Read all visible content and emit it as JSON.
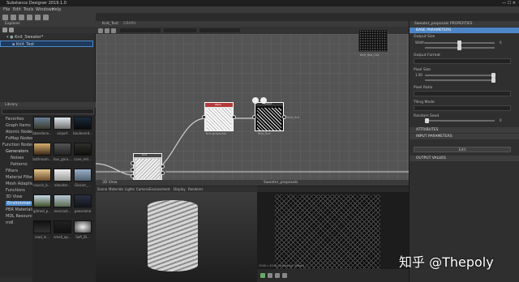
{
  "window": {
    "title": "Substance Designer 2019.1.0"
  },
  "menu": [
    "File",
    "Edit",
    "Tools",
    "Windows",
    "Help"
  ],
  "explorer": {
    "title": "Explorer",
    "package": "Knit_Sweater*",
    "graph": "Knit_Test"
  },
  "library": {
    "title": "Library",
    "categories": [
      "Favorites",
      "Graph Items",
      "Atomic Nodes",
      "FxMap Nodes",
      "Function Nodes",
      "Generators",
      "Noises",
      "Patterns",
      "Filters",
      "Material Filters",
      "Mesh Adaptive",
      "Functions",
      "3D View",
      "Environments",
      "PBR Materials",
      "MDL Resources",
      "mdl"
    ],
    "thumb_labels": [
      "abandone...",
      "airport",
      "boulevard...",
      "bathroom...",
      "bus_gara...",
      "cave_ent...",
      "cousin_b...",
      "elevator...",
      "Glacier_...",
      "gilmed_p...",
      "overcast...",
      "panorama",
      "road_in...",
      "small_ap...",
      "Soft_Bl..."
    ]
  },
  "graph_tab": {
    "title": "Knit_Test",
    "subtitle": "GRAPH"
  },
  "nodes": {
    "first": {
      "title": "Knit"
    },
    "warp": {
      "title": "Warp",
      "caption": "Knit grayscale"
    },
    "output": {
      "title": "Output",
      "caption": "Knit_Out",
      "tag": "Knit_Out"
    }
  },
  "graph_corner_caption": "Knit_Test_Out",
  "view3d": {
    "title": "3D View",
    "menu": [
      "Scene",
      "Materials",
      "Lights",
      "Camera",
      "Environment",
      "Display",
      "Renderer"
    ]
  },
  "view2d": {
    "title": "Sweater_proposals",
    "size": "2048 x 2048 (Grayscale, 16bpc)"
  },
  "properties": {
    "title": "Sweater_proposals",
    "tab": "PROPERTIES",
    "section_base": "BASE PARAMETERS",
    "params": [
      {
        "label": "Output Size",
        "sub": "Width",
        "value": "0"
      },
      {
        "label": "Output Format",
        "sub": "",
        "value": ""
      },
      {
        "label": "Pixel Size",
        "sub": "X/Y",
        "value": "1.00"
      },
      {
        "label": "Pixel Ratio",
        "sub": "",
        "value": ""
      },
      {
        "label": "Tiling Mode",
        "sub": "",
        "value": ""
      },
      {
        "label": "Random Seed",
        "sub": "",
        "value": "0"
      }
    ],
    "section_attributes": "ATTRIBUTES",
    "section_input": "INPUT PARAMETERS",
    "section_output": "OUTPUT VALUES",
    "button": "Edit"
  },
  "watermark": "知乎 @Thepoly",
  "colors": {
    "accent": "#4d87c7",
    "node_red": "#b23a3a",
    "panel": "#3a3a3a",
    "graph_bg": "#555555"
  }
}
